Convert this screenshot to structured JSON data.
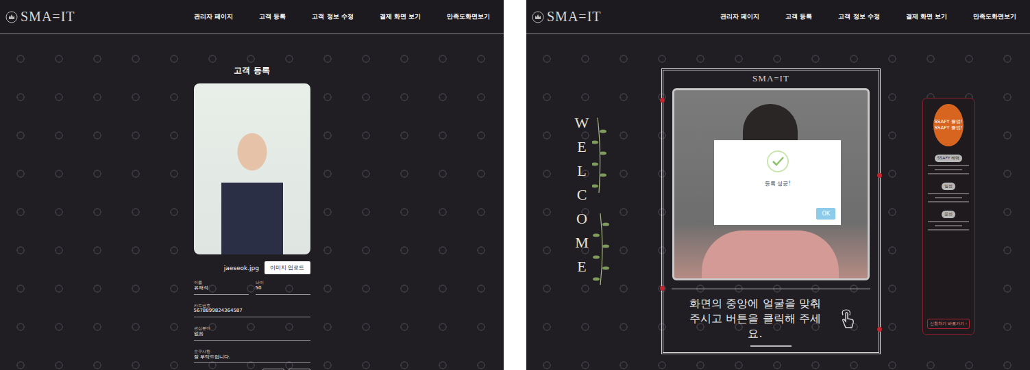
{
  "screens": [
    {
      "header": {
        "logo": "SMA=IT",
        "nav": [
          "관리자 페이지",
          "고객 등록",
          "고객 정보 수정",
          "결제 화면 보기",
          "만족도화면보기"
        ]
      },
      "registration": {
        "title": "고객 등록",
        "photo": {
          "filename": "jaeseok.jpg"
        },
        "upload_button": "이미지 업로드",
        "fields": [
          {
            "label": "이름",
            "value": "유재석"
          },
          {
            "label": "나이",
            "value": "50"
          },
          {
            "label": "카드번호",
            "value": "5678899824364587"
          },
          {
            "label": "관심분야",
            "value": "없음"
          },
          {
            "label": "요구사항",
            "value": "잘 부탁드립니다."
          }
        ]
      }
    },
    {
      "header": {
        "logo": "SMA=IT",
        "nav": [
          "관리자 페이지",
          "고객 등록",
          "고객 정보 수정",
          "결제 화면 보기",
          "만족도화면보기"
        ]
      },
      "kiosk": {
        "welcome": "WELCOME",
        "frame_logo": "SMA=IT",
        "dialog": {
          "message": "등록 성공!",
          "button": "OK"
        },
        "instruction": "화면의 중앙에 얼굴을 맞춰주시고 버튼을 클릭해 주세요.",
        "poster": {
          "headline": [
            "SSAFY 졸업!",
            "SSAFY 졸업!"
          ],
          "sections": [
            "SSAFY 혜택",
            "일정",
            "문의"
          ],
          "button": "신청하기 바로가기 ›"
        }
      }
    }
  ]
}
